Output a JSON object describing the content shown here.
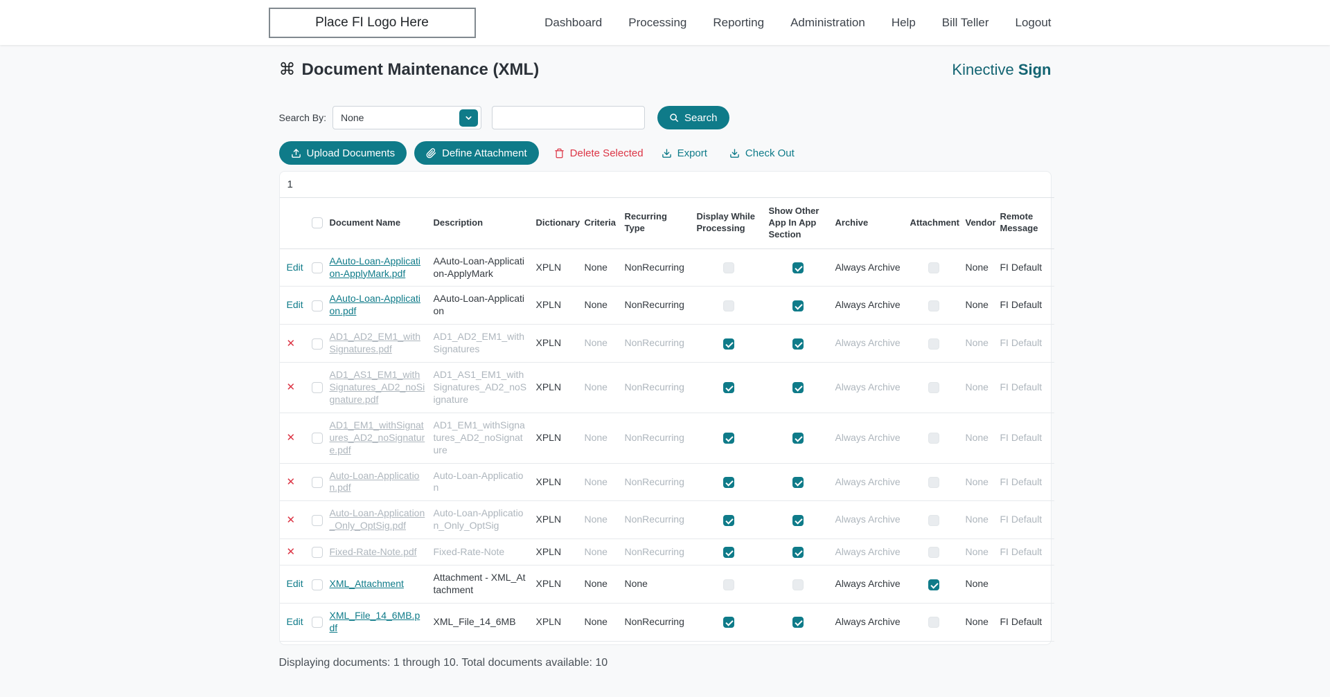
{
  "colors": {
    "accent": "#0F7B89",
    "brand_text": "#136472",
    "danger": "#DC3545"
  },
  "brand": {
    "logo_placeholder": "Place FI Logo Here",
    "product_name": "Kinective",
    "product_suffix": "Sign"
  },
  "nav": {
    "items": [
      "Dashboard",
      "Processing",
      "Reporting",
      "Administration",
      "Help",
      "Bill Teller",
      "Logout"
    ]
  },
  "page": {
    "title": "Document Maintenance (XML)",
    "title_icon": "⌘"
  },
  "search": {
    "label": "Search By:",
    "selected_option": "None",
    "input_value": "",
    "search_button": "Search"
  },
  "toolbar": {
    "upload": "Upload Documents",
    "define_attachment": "Define Attachment",
    "delete_selected": "Delete Selected",
    "export": "Export",
    "check_out": "Check Out"
  },
  "pagination": {
    "current_page": "1"
  },
  "table": {
    "edit_label": "Edit",
    "delete_glyph": "✕",
    "headers": [
      "Document Name",
      "Description",
      "Dictionary",
      "Criteria",
      "Recurring Type",
      "Display While Processing",
      "Show Other App In App Section",
      "Archive",
      "Attachment",
      "Vendor",
      "Remote Message"
    ],
    "rows": [
      {
        "action": "edit",
        "disabled": false,
        "name": "AAuto-Loan-Application-ApplyMark.pdf",
        "description": "AAuto-Loan-Application-ApplyMark",
        "dictionary": "XPLN",
        "criteria": "None",
        "recurring_type": "NonRecurring",
        "display_while_processing": false,
        "show_other_app": true,
        "archive": "Always Archive",
        "attachment": false,
        "vendor": "None",
        "remote_message": "FI Default"
      },
      {
        "action": "edit",
        "disabled": false,
        "name": "AAuto-Loan-Application.pdf",
        "description": "AAuto-Loan-Application",
        "dictionary": "XPLN",
        "criteria": "None",
        "recurring_type": "NonRecurring",
        "display_while_processing": false,
        "show_other_app": true,
        "archive": "Always Archive",
        "attachment": false,
        "vendor": "None",
        "remote_message": "FI Default"
      },
      {
        "action": "delete",
        "disabled": true,
        "name": "AD1_AD2_EM1_withSignatures.pdf",
        "description": "AD1_AD2_EM1_withSignatures",
        "dictionary": "XPLN",
        "criteria": "None",
        "recurring_type": "NonRecurring",
        "display_while_processing": true,
        "show_other_app": true,
        "archive": "Always Archive",
        "attachment": false,
        "vendor": "None",
        "remote_message": "FI Default"
      },
      {
        "action": "delete",
        "disabled": true,
        "name": "AD1_AS1_EM1_withSignatures_AD2_noSignature.pdf",
        "description": "AD1_AS1_EM1_withSignatures_AD2_noSignature",
        "dictionary": "XPLN",
        "criteria": "None",
        "recurring_type": "NonRecurring",
        "display_while_processing": true,
        "show_other_app": true,
        "archive": "Always Archive",
        "attachment": false,
        "vendor": "None",
        "remote_message": "FI Default"
      },
      {
        "action": "delete",
        "disabled": true,
        "name": "AD1_EM1_withSignatures_AD2_noSignature.pdf",
        "description": "AD1_EM1_withSignatures_AD2_noSignature",
        "dictionary": "XPLN",
        "criteria": "None",
        "recurring_type": "NonRecurring",
        "display_while_processing": true,
        "show_other_app": true,
        "archive": "Always Archive",
        "attachment": false,
        "vendor": "None",
        "remote_message": "FI Default"
      },
      {
        "action": "delete",
        "disabled": true,
        "name": "Auto-Loan-Application.pdf",
        "description": "Auto-Loan-Application",
        "dictionary": "XPLN",
        "criteria": "None",
        "recurring_type": "NonRecurring",
        "display_while_processing": true,
        "show_other_app": true,
        "archive": "Always Archive",
        "attachment": false,
        "vendor": "None",
        "remote_message": "FI Default"
      },
      {
        "action": "delete",
        "disabled": true,
        "name": "Auto-Loan-Application_Only_OptSig.pdf",
        "description": "Auto-Loan-Application_Only_OptSig",
        "dictionary": "XPLN",
        "criteria": "None",
        "recurring_type": "NonRecurring",
        "display_while_processing": true,
        "show_other_app": true,
        "archive": "Always Archive",
        "attachment": false,
        "vendor": "None",
        "remote_message": "FI Default"
      },
      {
        "action": "delete",
        "disabled": true,
        "name": "Fixed-Rate-Note.pdf",
        "description": "Fixed-Rate-Note",
        "dictionary": "XPLN",
        "criteria": "None",
        "recurring_type": "NonRecurring",
        "display_while_processing": true,
        "show_other_app": true,
        "archive": "Always Archive",
        "attachment": false,
        "vendor": "None",
        "remote_message": "FI Default"
      },
      {
        "action": "edit",
        "disabled": false,
        "name": "XML_Attachment",
        "description": "Attachment - XML_Attachment",
        "dictionary": "XPLN",
        "criteria": "None",
        "recurring_type": "None",
        "display_while_processing": false,
        "show_other_app": false,
        "archive": "Always Archive",
        "attachment": true,
        "vendor": "None",
        "remote_message": ""
      },
      {
        "action": "edit",
        "disabled": false,
        "name": "XML_File_14_6MB.pdf",
        "description": "XML_File_14_6MB",
        "dictionary": "XPLN",
        "criteria": "None",
        "recurring_type": "NonRecurring",
        "display_while_processing": true,
        "show_other_app": true,
        "archive": "Always Archive",
        "attachment": false,
        "vendor": "None",
        "remote_message": "FI Default"
      }
    ]
  },
  "footer": {
    "summary": "Displaying documents: 1 through 10. Total documents available: 10"
  }
}
